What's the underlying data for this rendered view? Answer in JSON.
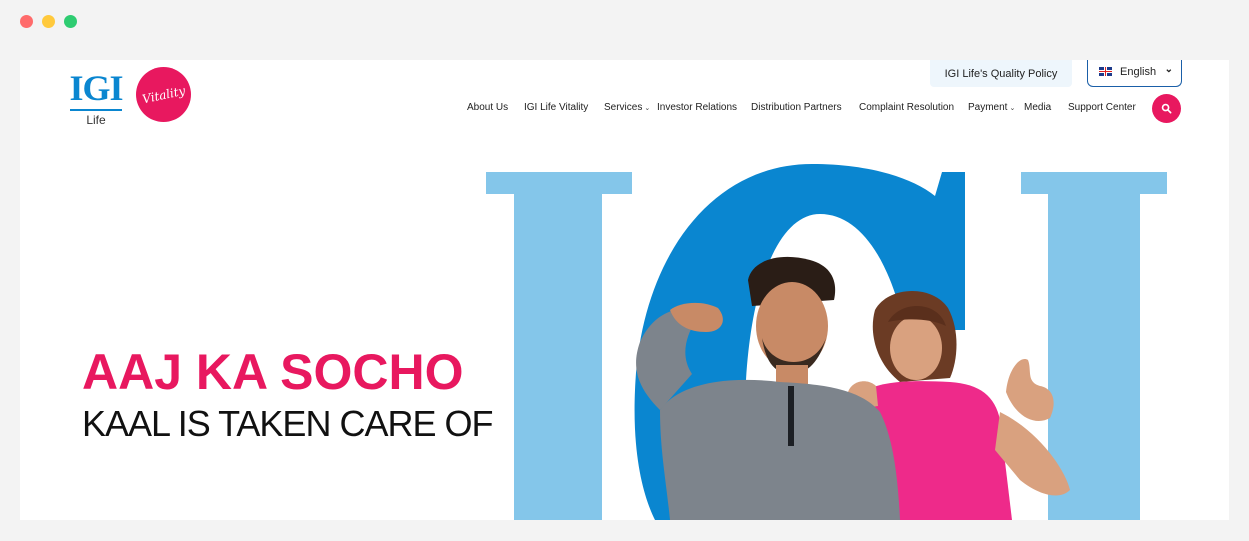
{
  "browser": {
    "controls": [
      "close",
      "minimize",
      "maximize"
    ]
  },
  "header": {
    "logo": {
      "wordmark": "IGI",
      "sub": "Life",
      "partner": "Vitality"
    },
    "quality_policy": "IGI Life's Quality Policy",
    "language": {
      "selected": "English",
      "flag": "uk-flag-icon"
    },
    "nav": [
      {
        "label": "About Us"
      },
      {
        "label": "IGI Life Vitality"
      },
      {
        "label": "Services",
        "dropdown": true
      },
      {
        "label": "Investor Relations"
      },
      {
        "label": "Distribution Partners"
      },
      {
        "label": "Complaint Resolution"
      },
      {
        "label": "Payment",
        "dropdown": true
      },
      {
        "label": "Media"
      },
      {
        "label": "Support Center"
      }
    ],
    "search_icon": "search-icon"
  },
  "hero": {
    "headline": "AAJ KA SOCHO",
    "subheadline": "KAAL IS TAKEN CARE OF",
    "image": "couple-with-IGI-letters"
  },
  "colors": {
    "brand_pink": "#e8185f",
    "brand_blue": "#0a86d0",
    "light_blue": "#84c6ea"
  }
}
